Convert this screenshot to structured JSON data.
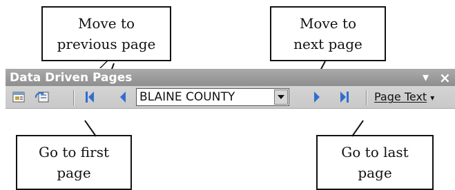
{
  "callouts": {
    "prev": [
      "Move to",
      "previous page"
    ],
    "next": [
      "Move to",
      "next page"
    ],
    "first": [
      "Go to first",
      "page"
    ],
    "last": [
      "Go to last",
      "page"
    ]
  },
  "toolbar": {
    "title": "Data Driven Pages",
    "close_glyph": "×",
    "menu_glyph": "▾",
    "page_value": "BLAINE COUNTY",
    "page_text_label": "Page Text",
    "page_text_arrow": "▾"
  },
  "colors": {
    "nav_blue": "#2f6fcf",
    "title_bg": "#9a9a9a",
    "toolbar_bg": "#d3d3d3"
  },
  "icons": [
    "setup-pages-icon",
    "refresh-icon",
    "first-page-icon",
    "previous-page-icon",
    "next-page-icon",
    "last-page-icon"
  ]
}
